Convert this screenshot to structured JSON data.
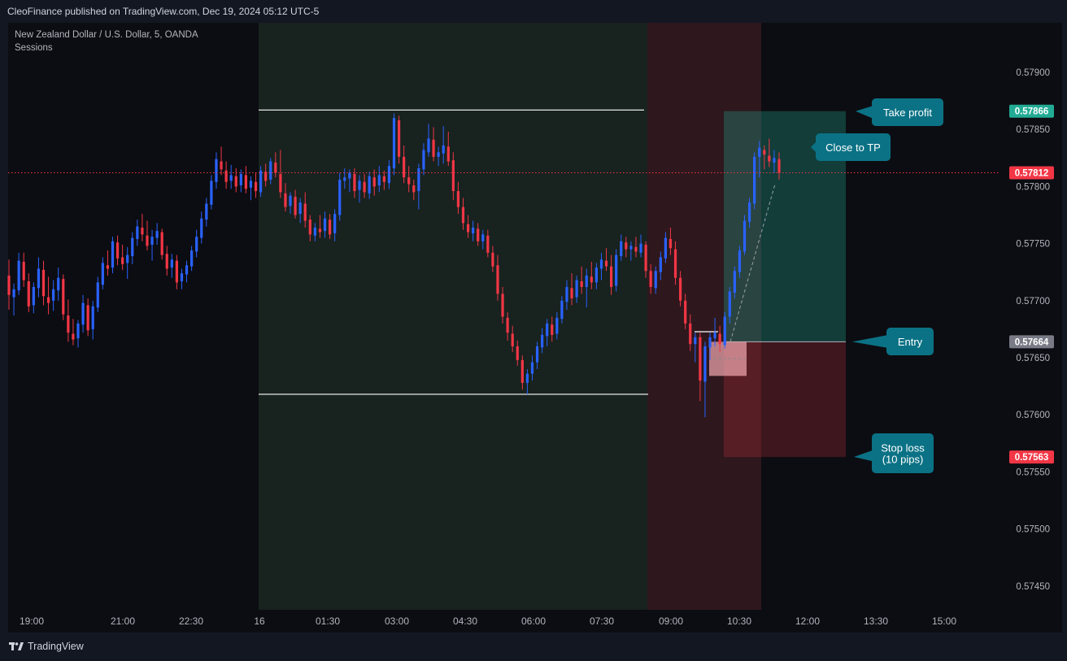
{
  "header": {
    "published_text": "CleoFinance published on TradingView.com, Dec 19, 2024 05:12 UTC-5"
  },
  "legend": {
    "symbol_line": "New Zealand Dollar / U.S. Dollar, 5, OANDA",
    "indicator": "Sessions"
  },
  "footer": {
    "brand": "TradingView"
  },
  "colors": {
    "background": "#131722",
    "up": "#2962ff",
    "down": "#f23645",
    "session_green": "#1c2a24",
    "session_red": "#3a1c22",
    "annotation_bg": "#0b7285",
    "tp_zone": "#22ab94",
    "sl_zone": "#f23645"
  },
  "chart_data": {
    "type": "candlestick",
    "ylim": [
      0.5743,
      0.5794
    ],
    "y_ticks": [
      "0.57900",
      "0.57850",
      "0.57800",
      "0.57750",
      "0.57700",
      "0.57650",
      "0.57600",
      "0.57550",
      "0.57500",
      "0.57450"
    ],
    "x_ticks": [
      "19:00",
      "21:00",
      "22:30",
      "16",
      "01:30",
      "03:00",
      "04:30",
      "06:00",
      "07:30",
      "09:00",
      "10:30",
      "12:00",
      "13:30",
      "15:00"
    ],
    "price_badges": [
      {
        "label": "0.57866",
        "value": 0.57866,
        "color": "#22ab94"
      },
      {
        "label": "0.57812",
        "value": 0.57812,
        "color": "#f23645"
      },
      {
        "label": "0.57664",
        "value": 0.57664,
        "color": "#787b86"
      },
      {
        "label": "0.57563",
        "value": 0.57563,
        "color": "#f23645"
      }
    ],
    "current_price": 0.57812,
    "position": {
      "entry": 0.57664,
      "take_profit": 0.57866,
      "stop_loss": 0.57563
    },
    "session_range": {
      "high": 0.57867,
      "low": 0.57618
    },
    "annotations": [
      {
        "label": "Take profit",
        "side": "left"
      },
      {
        "label": "Close to TP",
        "side": "left"
      },
      {
        "label": "Entry",
        "side": "left"
      },
      {
        "label": "Stop loss\n(10 pips)",
        "side": "top"
      }
    ],
    "candles": [
      [
        0.57722,
        0.57736,
        0.57692,
        0.57705
      ],
      [
        0.57703,
        0.57715,
        0.57687,
        0.5771
      ],
      [
        0.57709,
        0.57742,
        0.57705,
        0.57735
      ],
      [
        0.57734,
        0.57742,
        0.57712,
        0.57718
      ],
      [
        0.57717,
        0.57724,
        0.5769,
        0.57695
      ],
      [
        0.57696,
        0.57716,
        0.57689,
        0.57712
      ],
      [
        0.57711,
        0.57738,
        0.57703,
        0.57728
      ],
      [
        0.57727,
        0.57735,
        0.57696,
        0.57704
      ],
      [
        0.57703,
        0.57721,
        0.57688,
        0.57698
      ],
      [
        0.577,
        0.57718,
        0.57691,
        0.5771
      ],
      [
        0.57709,
        0.57729,
        0.577,
        0.5772
      ],
      [
        0.57719,
        0.57723,
        0.57683,
        0.57688
      ],
      [
        0.57687,
        0.57701,
        0.57664,
        0.57672
      ],
      [
        0.57671,
        0.57684,
        0.57661,
        0.57666
      ],
      [
        0.57667,
        0.57683,
        0.57659,
        0.5768
      ],
      [
        0.57679,
        0.57705,
        0.57672,
        0.57698
      ],
      [
        0.57696,
        0.57702,
        0.57669,
        0.57674
      ],
      [
        0.57675,
        0.577,
        0.57666,
        0.57695
      ],
      [
        0.57694,
        0.57721,
        0.5769,
        0.57716
      ],
      [
        0.57714,
        0.57738,
        0.5771,
        0.57733
      ],
      [
        0.57731,
        0.57744,
        0.57722,
        0.57728
      ],
      [
        0.57729,
        0.57756,
        0.57724,
        0.57752
      ],
      [
        0.57751,
        0.57757,
        0.57731,
        0.57737
      ],
      [
        0.57738,
        0.57749,
        0.57727,
        0.57732
      ],
      [
        0.57733,
        0.57747,
        0.57719,
        0.5774
      ],
      [
        0.57739,
        0.5776,
        0.57732,
        0.57755
      ],
      [
        0.57754,
        0.57771,
        0.57748,
        0.57765
      ],
      [
        0.57764,
        0.57776,
        0.57752,
        0.57758
      ],
      [
        0.57757,
        0.5777,
        0.57744,
        0.57748
      ],
      [
        0.57749,
        0.57762,
        0.57735,
        0.57756
      ],
      [
        0.57755,
        0.57768,
        0.57749,
        0.57761
      ],
      [
        0.5776,
        0.57763,
        0.57736,
        0.5774
      ],
      [
        0.57741,
        0.57748,
        0.57722,
        0.57728
      ],
      [
        0.57729,
        0.57741,
        0.5772,
        0.57736
      ],
      [
        0.57735,
        0.5774,
        0.5771,
        0.57716
      ],
      [
        0.57717,
        0.57728,
        0.5771,
        0.57724
      ],
      [
        0.57723,
        0.57735,
        0.57716,
        0.57731
      ],
      [
        0.5773,
        0.57748,
        0.57726,
        0.57744
      ],
      [
        0.57743,
        0.57762,
        0.57738,
        0.57756
      ],
      [
        0.57755,
        0.57778,
        0.5775,
        0.57772
      ],
      [
        0.57771,
        0.5779,
        0.57765,
        0.57785
      ],
      [
        0.57784,
        0.5781,
        0.5778,
        0.57805
      ],
      [
        0.57804,
        0.5783,
        0.57798,
        0.57824
      ],
      [
        0.57822,
        0.57835,
        0.5781,
        0.57815
      ],
      [
        0.57814,
        0.57822,
        0.57798,
        0.57804
      ],
      [
        0.57805,
        0.57819,
        0.57798,
        0.5781
      ],
      [
        0.57809,
        0.57816,
        0.57795,
        0.578
      ],
      [
        0.57801,
        0.57815,
        0.57795,
        0.57811
      ],
      [
        0.5781,
        0.57818,
        0.57794,
        0.57798
      ],
      [
        0.57799,
        0.57809,
        0.57788,
        0.57805
      ],
      [
        0.57804,
        0.57812,
        0.5779,
        0.57796
      ],
      [
        0.57795,
        0.57818,
        0.57791,
        0.57814
      ],
      [
        0.57813,
        0.5782,
        0.578,
        0.57805
      ],
      [
        0.57806,
        0.57825,
        0.57802,
        0.57822
      ],
      [
        0.57821,
        0.5783,
        0.57808,
        0.57812
      ],
      [
        0.57811,
        0.57832,
        0.5779,
        0.57795
      ],
      [
        0.57794,
        0.57803,
        0.57778,
        0.57782
      ],
      [
        0.57783,
        0.57795,
        0.57776,
        0.57792
      ],
      [
        0.57791,
        0.57797,
        0.57772,
        0.57775
      ],
      [
        0.57776,
        0.5779,
        0.57768,
        0.57786
      ],
      [
        0.57785,
        0.57795,
        0.57764,
        0.5777
      ],
      [
        0.57771,
        0.57775,
        0.57752,
        0.57758
      ],
      [
        0.57757,
        0.57768,
        0.57752,
        0.57764
      ],
      [
        0.57763,
        0.57775,
        0.57755,
        0.5776
      ],
      [
        0.57761,
        0.57778,
        0.57755,
        0.57772
      ],
      [
        0.57771,
        0.57776,
        0.57754,
        0.57758
      ],
      [
        0.57759,
        0.5778,
        0.57752,
        0.57776
      ],
      [
        0.57775,
        0.57812,
        0.5777,
        0.57806
      ],
      [
        0.57805,
        0.57816,
        0.57798,
        0.57808
      ],
      [
        0.57807,
        0.57815,
        0.57795,
        0.57812
      ],
      [
        0.57811,
        0.57816,
        0.5779,
        0.57796
      ],
      [
        0.57797,
        0.5781,
        0.57786,
        0.57805
      ],
      [
        0.57804,
        0.57811,
        0.5779,
        0.57795
      ],
      [
        0.57794,
        0.57813,
        0.57789,
        0.57809
      ],
      [
        0.57808,
        0.57815,
        0.57792,
        0.578
      ],
      [
        0.57801,
        0.57818,
        0.57795,
        0.5781
      ],
      [
        0.57809,
        0.57814,
        0.57797,
        0.57804
      ],
      [
        0.57803,
        0.57823,
        0.57798,
        0.57818
      ],
      [
        0.57816,
        0.57864,
        0.5781,
        0.5786
      ],
      [
        0.57858,
        0.57862,
        0.5782,
        0.57826
      ],
      [
        0.57826,
        0.57836,
        0.57803,
        0.57808
      ],
      [
        0.57808,
        0.57818,
        0.57795,
        0.57802
      ],
      [
        0.57801,
        0.57806,
        0.57788,
        0.57795
      ],
      [
        0.57796,
        0.5782,
        0.5778,
        0.57816
      ],
      [
        0.57815,
        0.57838,
        0.5781,
        0.57832
      ],
      [
        0.5783,
        0.57855,
        0.57826,
        0.57842
      ],
      [
        0.57841,
        0.57852,
        0.57822,
        0.57826
      ],
      [
        0.57826,
        0.57835,
        0.57818,
        0.5783
      ],
      [
        0.57829,
        0.57853,
        0.5782,
        0.57836
      ],
      [
        0.57835,
        0.57848,
        0.57818,
        0.57822
      ],
      [
        0.57823,
        0.5783,
        0.57788,
        0.57796
      ],
      [
        0.57796,
        0.57804,
        0.57776,
        0.57782
      ],
      [
        0.57782,
        0.5779,
        0.57762,
        0.57768
      ],
      [
        0.57767,
        0.57775,
        0.57755,
        0.5776
      ],
      [
        0.57759,
        0.5777,
        0.57752,
        0.57764
      ],
      [
        0.57763,
        0.57768,
        0.57748,
        0.57752
      ],
      [
        0.57752,
        0.57762,
        0.57745,
        0.57758
      ],
      [
        0.57757,
        0.57762,
        0.57738,
        0.57742
      ],
      [
        0.57742,
        0.57748,
        0.57725,
        0.5773
      ],
      [
        0.57731,
        0.5774,
        0.577,
        0.57706
      ],
      [
        0.57706,
        0.57712,
        0.5768,
        0.57686
      ],
      [
        0.57685,
        0.5769,
        0.57665,
        0.57672
      ],
      [
        0.57671,
        0.57678,
        0.57655,
        0.5766
      ],
      [
        0.5766,
        0.57665,
        0.57643,
        0.57648
      ],
      [
        0.57648,
        0.57652,
        0.57622,
        0.57628
      ],
      [
        0.57628,
        0.5764,
        0.57618,
        0.57636
      ],
      [
        0.57636,
        0.57652,
        0.5763,
        0.57646
      ],
      [
        0.57646,
        0.57664,
        0.5764,
        0.5766
      ],
      [
        0.57659,
        0.57676,
        0.57654,
        0.5767
      ],
      [
        0.57669,
        0.57684,
        0.5766,
        0.5768
      ],
      [
        0.57679,
        0.57686,
        0.57664,
        0.5767
      ],
      [
        0.57671,
        0.5769,
        0.57666,
        0.57685
      ],
      [
        0.57684,
        0.57704,
        0.5768,
        0.577
      ],
      [
        0.57699,
        0.57718,
        0.57692,
        0.57712
      ],
      [
        0.57711,
        0.57724,
        0.57696,
        0.57702
      ],
      [
        0.57703,
        0.57722,
        0.57698,
        0.57718
      ],
      [
        0.57717,
        0.5773,
        0.57706,
        0.57712
      ],
      [
        0.57712,
        0.57728,
        0.57694,
        0.57722
      ],
      [
        0.57721,
        0.57734,
        0.5771,
        0.57716
      ],
      [
        0.57716,
        0.57733,
        0.5771,
        0.57729
      ],
      [
        0.57728,
        0.57742,
        0.57718,
        0.57736
      ],
      [
        0.57735,
        0.57746,
        0.57726,
        0.5773
      ],
      [
        0.5773,
        0.5774,
        0.57705,
        0.57712
      ],
      [
        0.57713,
        0.57745,
        0.57708,
        0.5774
      ],
      [
        0.57739,
        0.57758,
        0.57735,
        0.57752
      ],
      [
        0.57751,
        0.57756,
        0.57738,
        0.57745
      ],
      [
        0.57745,
        0.57752,
        0.57735,
        0.57748
      ],
      [
        0.57747,
        0.57756,
        0.57738,
        0.57743
      ],
      [
        0.57742,
        0.57758,
        0.57738,
        0.5775
      ],
      [
        0.57749,
        0.57752,
        0.5772,
        0.57726
      ],
      [
        0.57726,
        0.57732,
        0.57706,
        0.57712
      ],
      [
        0.57711,
        0.5773,
        0.57706,
        0.57726
      ],
      [
        0.57725,
        0.57743,
        0.57718,
        0.57738
      ],
      [
        0.57737,
        0.5776,
        0.57733,
        0.57755
      ],
      [
        0.57754,
        0.57764,
        0.5774,
        0.57746
      ],
      [
        0.57745,
        0.57752,
        0.57714,
        0.5772
      ],
      [
        0.5772,
        0.57726,
        0.57695,
        0.577
      ],
      [
        0.577,
        0.57706,
        0.57675,
        0.5768
      ],
      [
        0.5768,
        0.57688,
        0.57656,
        0.57662
      ],
      [
        0.57662,
        0.57672,
        0.57646,
        0.57668
      ],
      [
        0.57668,
        0.57672,
        0.57612,
        0.5763
      ],
      [
        0.57629,
        0.57664,
        0.57598,
        0.5766
      ],
      [
        0.57659,
        0.57672,
        0.57648,
        0.57668
      ],
      [
        0.57667,
        0.57685,
        0.5766,
        0.57672
      ],
      [
        0.57671,
        0.57678,
        0.57655,
        0.57662
      ],
      [
        0.57661,
        0.5769,
        0.57658,
        0.57686
      ],
      [
        0.57686,
        0.57712,
        0.5768,
        0.57708
      ],
      [
        0.57707,
        0.5773,
        0.57702,
        0.57726
      ],
      [
        0.57725,
        0.57748,
        0.5772,
        0.57744
      ],
      [
        0.57743,
        0.57775,
        0.5774,
        0.5777
      ],
      [
        0.57769,
        0.5779,
        0.57764,
        0.57786
      ],
      [
        0.57785,
        0.5783,
        0.5778,
        0.57826
      ],
      [
        0.57826,
        0.5784,
        0.57808,
        0.57834
      ],
      [
        0.57832,
        0.57836,
        0.57815,
        0.57828
      ],
      [
        0.57827,
        0.57842,
        0.57817,
        0.57822
      ],
      [
        0.57821,
        0.57832,
        0.57812,
        0.57825
      ],
      [
        0.57824,
        0.5783,
        0.57806,
        0.57812
      ]
    ]
  }
}
